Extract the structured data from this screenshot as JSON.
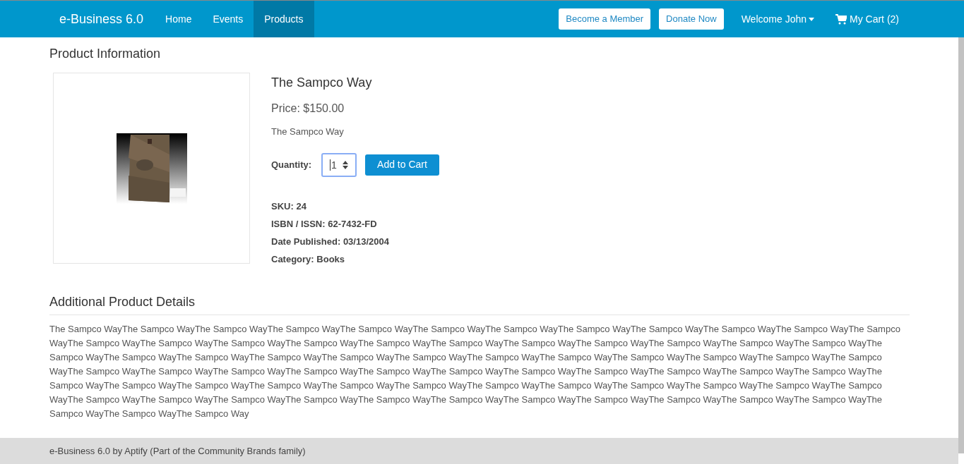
{
  "navbar": {
    "brand": "e-Business 6.0",
    "items": [
      {
        "label": "Home",
        "selected": false
      },
      {
        "label": "Events",
        "selected": false
      },
      {
        "label": "Products",
        "selected": true
      }
    ],
    "buttons": [
      "Become a Member",
      "Donate Now"
    ],
    "user_menu": "Welcome John",
    "cart": "My Cart (2)"
  },
  "page_title": "Product Information",
  "product": {
    "name": "The Sampco Way",
    "price": "Price: $150.00",
    "description": "The Sampco Way",
    "quantity_label": "Quantity:",
    "quantity": "1",
    "add_button": "Add to Cart",
    "attributes": [
      {
        "label": "SKU:",
        "value": "24"
      },
      {
        "label": "ISBN / ISSN:",
        "value": "62-7432-FD"
      },
      {
        "label": "Date Published:",
        "value": "03/13/2004"
      },
      {
        "label": "Category:",
        "value": "Books"
      }
    ]
  },
  "details": {
    "heading": "Additional Product Details",
    "text": "The Sampco WayThe Sampco WayThe Sampco WayThe Sampco WayThe Sampco WayThe Sampco WayThe Sampco WayThe Sampco WayThe Sampco WayThe Sampco WayThe Sampco WayThe Sampco WayThe Sampco WayThe Sampco WayThe Sampco WayThe Sampco WayThe Sampco WayThe Sampco WayThe Sampco WayThe Sampco WayThe Sampco WayThe Sampco WayThe Sampco WayThe Sampco WayThe Sampco WayThe Sampco WayThe Sampco WayThe Sampco WayThe Sampco WayThe Sampco WayThe Sampco WayThe Sampco WayThe Sampco WayThe Sampco WayThe Sampco WayThe Sampco WayThe Sampco WayThe Sampco WayThe Sampco WayThe Sampco WayThe Sampco WayThe Sampco WayThe Sampco WayThe Sampco WayThe Sampco WayThe Sampco WayThe Sampco WayThe Sampco WayThe Sampco WayThe Sampco WayThe Sampco WayThe Sampco WayThe Sampco WayThe Sampco WayThe Sampco WayThe Sampco WayThe Sampco WayThe Sampco WayThe Sampco WayThe Sampco WayThe Sampco WayThe Sampco WayThe Sampco WayThe Sampco WayThe Sampco WayThe Sampco WayThe Sampco WayThe Sampco WayThe Sampco WayThe Sampco WayThe Sampco WayThe Sampco Way"
  },
  "footer": "e-Business 6.0 by Aptify (Part of the Community Brands family)"
}
